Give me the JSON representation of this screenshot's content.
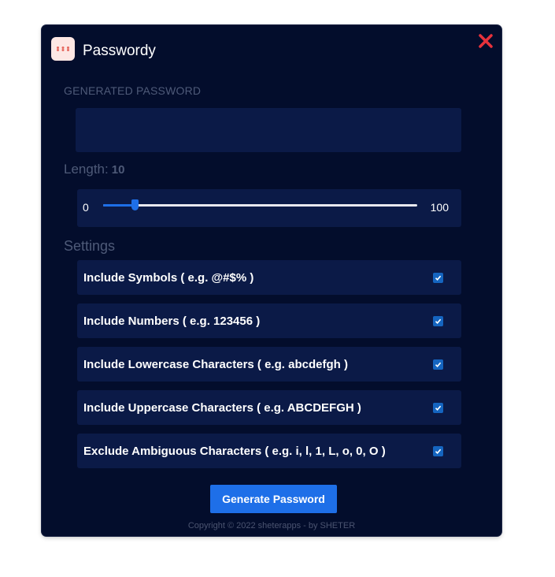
{
  "app": {
    "title": "Passwordy",
    "icon": "app-icon",
    "close_icon": "close-icon"
  },
  "password": {
    "label": "GENERATED PASSWORD",
    "value": ""
  },
  "length": {
    "label": "Length:",
    "value": "10",
    "min": "0",
    "max": "100",
    "current": 10
  },
  "settings": {
    "label": "Settings",
    "options": [
      {
        "label": "Include Symbols ( e.g. @#$% )",
        "checked": true
      },
      {
        "label": "Include Numbers ( e.g. 123456 )",
        "checked": true
      },
      {
        "label": "Include Lowercase Characters ( e.g. abcdefgh )",
        "checked": true
      },
      {
        "label": "Include Uppercase Characters ( e.g. ABCDEFGH )",
        "checked": true
      },
      {
        "label": "Exclude Ambiguous Characters ( e.g. i, l, 1, L, o, 0, O )",
        "checked": true
      }
    ]
  },
  "actions": {
    "generate_label": "Generate Password"
  },
  "footer": {
    "copyright": "Copyright © 2022 sheterapps - by SHETER"
  },
  "colors": {
    "background": "#030d2c",
    "panel": "#0b1a47",
    "accent": "#1e6fe8",
    "close": "#e8323c",
    "muted_text": "#4e5a78"
  }
}
